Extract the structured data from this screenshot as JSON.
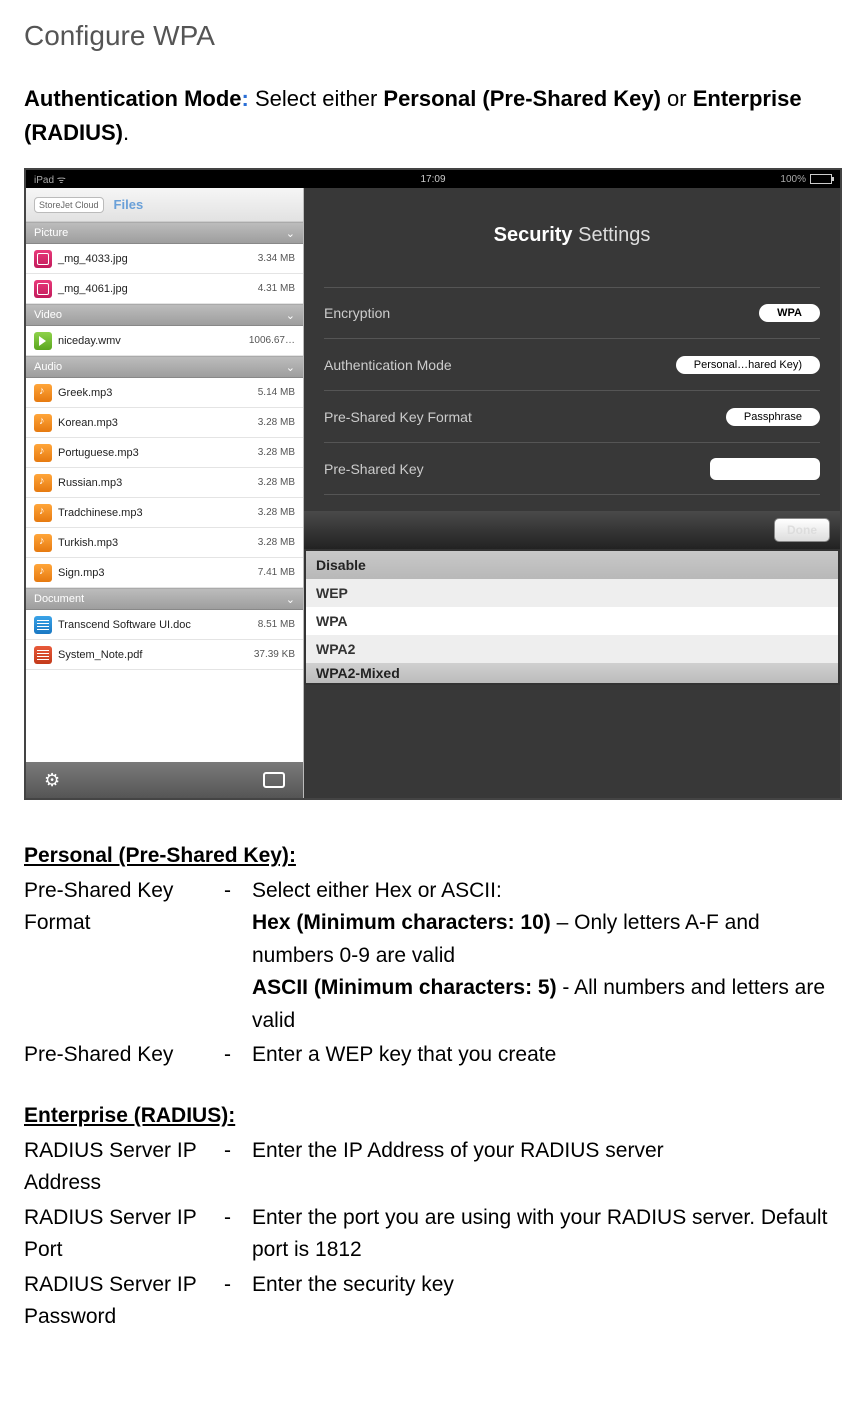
{
  "title": "Configure WPA",
  "intro_prefix": "Authentication Mode",
  "intro_colon": ":",
  "intro_mid": " Select either ",
  "intro_b1": "Personal (Pre-Shared Key)",
  "intro_or": " or ",
  "intro_b2": "Enterprise (RADIUS)",
  "intro_end": ".",
  "statusbar": {
    "left": "iPad ᯤ",
    "center": "17:09",
    "right": "100%"
  },
  "sidebar": {
    "logo": "StoreJet Cloud",
    "files": "Files",
    "sections": {
      "picture": "Picture",
      "video": "Video",
      "audio": "Audio",
      "document": "Document"
    },
    "pictures": [
      {
        "name": "_mg_4033.jpg",
        "size": "3.34 MB"
      },
      {
        "name": "_mg_4061.jpg",
        "size": "4.31 MB"
      }
    ],
    "videos": [
      {
        "name": "niceday.wmv",
        "size": "1006.67…"
      }
    ],
    "audios": [
      {
        "name": "Greek.mp3",
        "size": "5.14 MB"
      },
      {
        "name": "Korean.mp3",
        "size": "3.28 MB"
      },
      {
        "name": "Portuguese.mp3",
        "size": "3.28 MB"
      },
      {
        "name": "Russian.mp3",
        "size": "3.28 MB"
      },
      {
        "name": "Tradchinese.mp3",
        "size": "3.28 MB"
      },
      {
        "name": "Turkish.mp3",
        "size": "3.28 MB"
      },
      {
        "name": "Sign.mp3",
        "size": "7.41 MB"
      }
    ],
    "documents": [
      {
        "name": "Transcend Software UI.doc",
        "size": "8.51 MB"
      },
      {
        "name": "System_Note.pdf",
        "size": "37.39 KB"
      }
    ]
  },
  "main": {
    "title_b": "Security",
    "title_rest": " Settings",
    "rows": {
      "encryption": {
        "label": "Encryption",
        "value": "WPA"
      },
      "authmode": {
        "label": "Authentication Mode",
        "value": "Personal…hared Key)"
      },
      "pskformat": {
        "label": "Pre-Shared Key Format",
        "value": "Passphrase"
      },
      "psk": {
        "label": "Pre-Shared Key"
      }
    },
    "done": "Done",
    "picker": [
      "Disable",
      "WEP",
      "WPA",
      "WPA2",
      "WPA2-Mixed"
    ]
  },
  "doc": {
    "h_personal": "Personal (Pre-Shared Key)",
    "personal": [
      {
        "term": "Pre-Shared Key Format",
        "lines": [
          {
            "t": "Select either Hex or ASCII:"
          },
          {
            "b": "Hex (Minimum characters: 10)",
            "t": " – Only letters A-F and numbers 0-9 are valid"
          },
          {
            "b": "ASCII (Minimum characters: 5)",
            "t": " - All numbers and letters are valid"
          }
        ]
      },
      {
        "term": "Pre-Shared Key",
        "lines": [
          {
            "t": "Enter a WEP key that you create"
          }
        ]
      }
    ],
    "h_enterprise": "Enterprise (RADIUS)",
    "enterprise": [
      {
        "term": "RADIUS Server IP Address",
        "lines": [
          {
            "t": "Enter the IP Address of your RADIUS server"
          }
        ]
      },
      {
        "term": "RADIUS Server IP Port",
        "lines": [
          {
            "t": "Enter the port you are using with your RADIUS server. Default port is 1812"
          }
        ]
      },
      {
        "term": "RADIUS Server IP Password",
        "lines": [
          {
            "t": "Enter the security key"
          }
        ]
      }
    ]
  }
}
